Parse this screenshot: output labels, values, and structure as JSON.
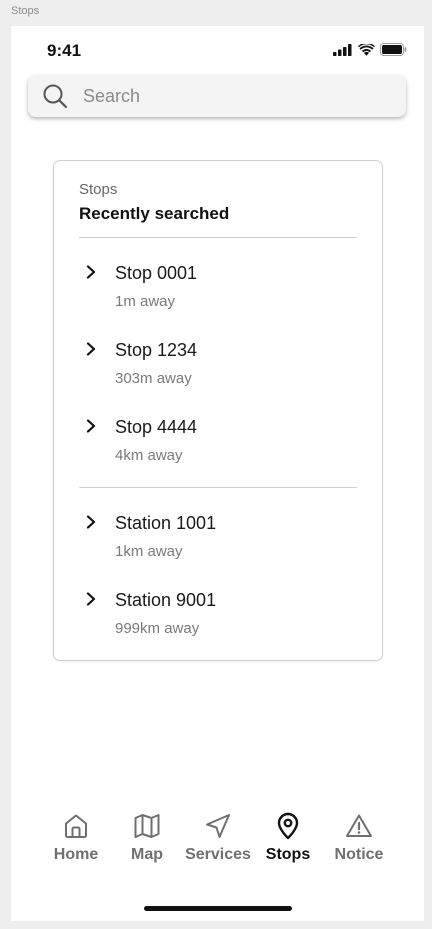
{
  "frame_label": "Stops",
  "status_bar": {
    "time": "9:41",
    "icons": [
      "signal-icon",
      "wifi-icon",
      "battery-icon"
    ]
  },
  "search": {
    "placeholder": "Search",
    "value": "",
    "icon": "search-icon"
  },
  "card": {
    "eyebrow": "Stops",
    "heading": "Recently searched",
    "stops": [
      {
        "name": "Stop 0001",
        "distance": "1m away"
      },
      {
        "name": "Stop 1234",
        "distance": "303m away"
      },
      {
        "name": "Stop 4444",
        "distance": "4km away"
      }
    ],
    "stations": [
      {
        "name": "Station 1001",
        "distance": "1km away"
      },
      {
        "name": "Station 9001",
        "distance": "999km away"
      }
    ]
  },
  "tabs": [
    {
      "label": "Home",
      "icon": "home-icon",
      "active": false
    },
    {
      "label": "Map",
      "icon": "map-icon",
      "active": false
    },
    {
      "label": "Services",
      "icon": "navigation-icon",
      "active": false
    },
    {
      "label": "Stops",
      "icon": "location-pin-icon",
      "active": true
    },
    {
      "label": "Notice",
      "icon": "warning-icon",
      "active": false
    }
  ],
  "colors": {
    "active_tab": "#111111",
    "inactive_tab": "#6f6f6f",
    "card_border": "#cfcfcf",
    "search_bg": "#f4f4f4"
  }
}
